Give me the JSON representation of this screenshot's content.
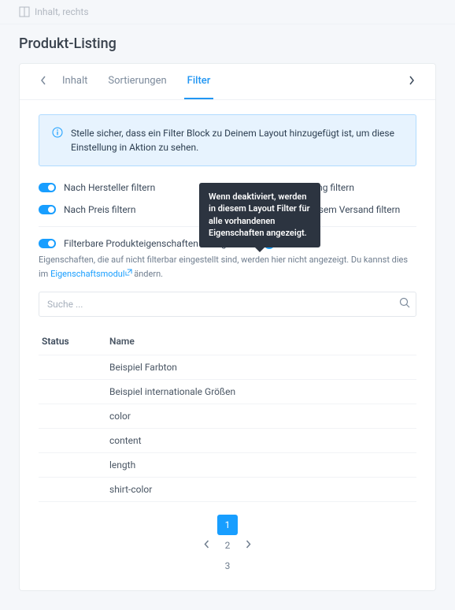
{
  "breadcrumb": {
    "label": "Inhalt, rechts"
  },
  "page": {
    "title": "Produkt-Listing"
  },
  "tabs": {
    "items": [
      {
        "label": "Inhalt",
        "active": false
      },
      {
        "label": "Sortierungen",
        "active": false
      },
      {
        "label": "Filter",
        "active": true
      }
    ]
  },
  "alert": {
    "text": "Stelle sicher, dass ein Filter Block zu Deinem Layout hinzugefügt ist, um diese Einstellung in Aktion zu sehen."
  },
  "filters": {
    "manufacturer": {
      "label": "Nach Hersteller filtern",
      "on": true
    },
    "rating": {
      "label": "Nach Bewertung filtern",
      "on": true
    },
    "price": {
      "label": "Nach Preis filtern",
      "on": true
    },
    "freeship": {
      "label": "Nach kostenlosem Versand filtern",
      "on": true
    }
  },
  "section": {
    "title": "Filterbare Produkteigenschaften konfigurieren",
    "toggle_on": true,
    "tooltip": "Wenn deaktiviert, werden in diesem Layout Filter für alle vorhandenen Eigenschaften angezeigt.",
    "hint_prefix": "Eigenschaften, die auf nicht filterbar eingestellt sind, werden hier nicht angezeigt. Du kannst dies im ",
    "hint_link": "Eigenschaftsmodul",
    "hint_suffix": " ändern."
  },
  "search": {
    "placeholder": "Suche ..."
  },
  "table": {
    "headers": {
      "status": "Status",
      "name": "Name"
    },
    "rows": [
      {
        "on": true,
        "name": "Beispiel Farbton"
      },
      {
        "on": true,
        "name": "Beispiel internationale Größen"
      },
      {
        "on": false,
        "name": "color"
      },
      {
        "on": false,
        "name": "content"
      },
      {
        "on": false,
        "name": "length"
      },
      {
        "on": false,
        "name": "shirt-color"
      }
    ]
  },
  "pagination": {
    "pages": [
      "1",
      "2",
      "3"
    ],
    "active": 0
  }
}
